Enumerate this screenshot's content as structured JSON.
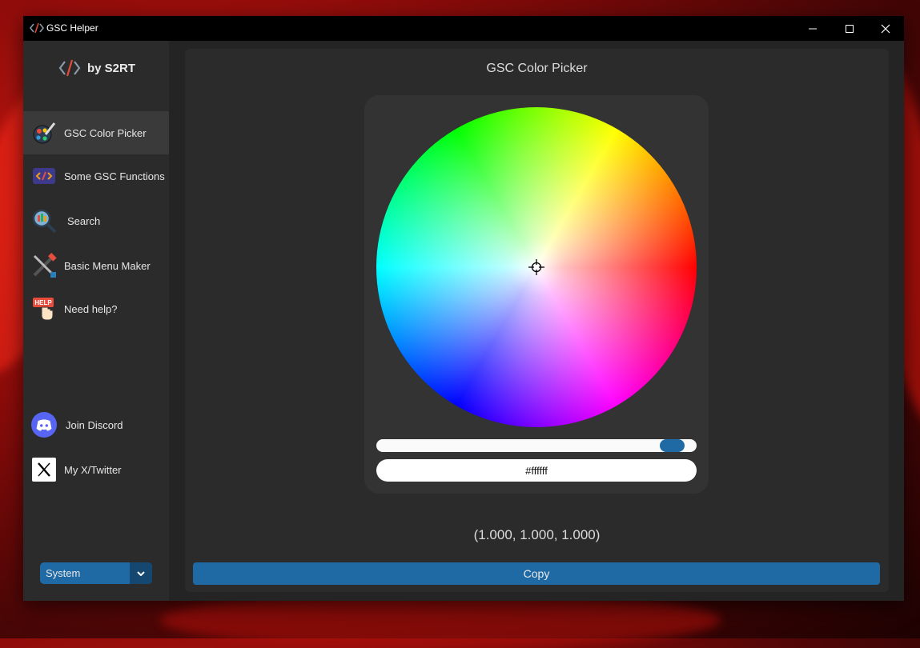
{
  "window": {
    "title": "GSC Helper"
  },
  "sidebar": {
    "brand": "by S2RT",
    "items": [
      {
        "label": "GSC Color Picker",
        "icon": "color-picker-icon"
      },
      {
        "label": "Some GSC Functions",
        "icon": "code-icon"
      },
      {
        "label": "Search",
        "icon": "search-icon"
      },
      {
        "label": "Basic Menu Maker",
        "icon": "tools-icon"
      },
      {
        "label": "Need help?",
        "icon": "help-icon"
      },
      {
        "label": "Join Discord",
        "icon": "discord-icon"
      },
      {
        "label": "My X/Twitter",
        "icon": "x-twitter-icon"
      }
    ],
    "theme_select": {
      "value": "System"
    }
  },
  "main": {
    "title": "GSC Color Picker",
    "brightness": 1.0,
    "hex_value": "#ffffff",
    "rgb_text": "(1.000, 1.000, 1.000)",
    "copy_label": "Copy"
  },
  "colors": {
    "accent": "#1f6aa5",
    "accent_dark": "#144870",
    "sidebar_bg": "#2b2b2b",
    "window_bg": "#242424",
    "titlebar_bg": "#000000"
  }
}
